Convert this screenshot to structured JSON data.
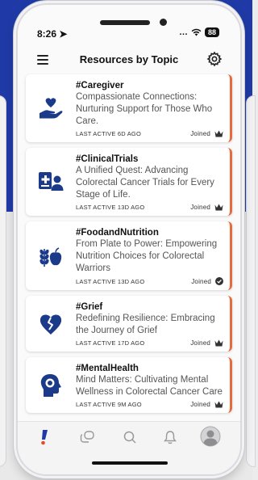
{
  "status_bar": {
    "time": "8:26",
    "battery": "88"
  },
  "header": {
    "title": "Resources by Topic",
    "menu_icon": "hamburger-menu-icon",
    "settings_icon": "gear-icon"
  },
  "topics": [
    {
      "tag": "#Caregiver",
      "description": "Compassionate Connections: Nurturing Support for Those Who Care.",
      "last_active": "LAST ACTIVE 6D AGO",
      "status": "Joined",
      "icon": "caring-hand-heart-icon",
      "status_icon": "crown-icon"
    },
    {
      "tag": "#ClinicalTrials",
      "description": "A Unified Quest: Advancing Colorectal Cancer Trials for Every Stage of Life.",
      "last_active": "LAST ACTIVE 13D AGO",
      "status": "Joined",
      "icon": "medical-person-icon",
      "status_icon": "crown-icon"
    },
    {
      "tag": "#FoodandNutrition",
      "description": "From Plate to Power: Empowering Nutrition Choices for Colorectal Warriors",
      "last_active": "LAST ACTIVE 13D AGO",
      "status": "Joined",
      "icon": "wheat-apple-icon",
      "status_icon": "check-circle-icon"
    },
    {
      "tag": "#Grief",
      "description": "Redefining Resilience: Embracing the Journey of Grief",
      "last_active": "LAST ACTIVE 17D AGO",
      "status": "Joined",
      "icon": "broken-heart-icon",
      "status_icon": "crown-icon"
    },
    {
      "tag": "#MentalHealth",
      "description": "Mind Matters: Cultivating Mental Wellness in Colorectal Cancer Care",
      "last_active": "LAST ACTIVE 9M AGO",
      "status": "Joined",
      "icon": "head-brain-icon",
      "status_icon": "crown-icon"
    }
  ],
  "tabbar": {
    "tabs": [
      "home-exclamation-icon",
      "chat-bubbles-icon",
      "search-icon",
      "bell-icon",
      "profile-avatar-icon"
    ]
  },
  "colors": {
    "brand_blue": "#1f3aa6",
    "accent_orange": "#e56a3c",
    "icon_navy": "#1b3a8a"
  }
}
